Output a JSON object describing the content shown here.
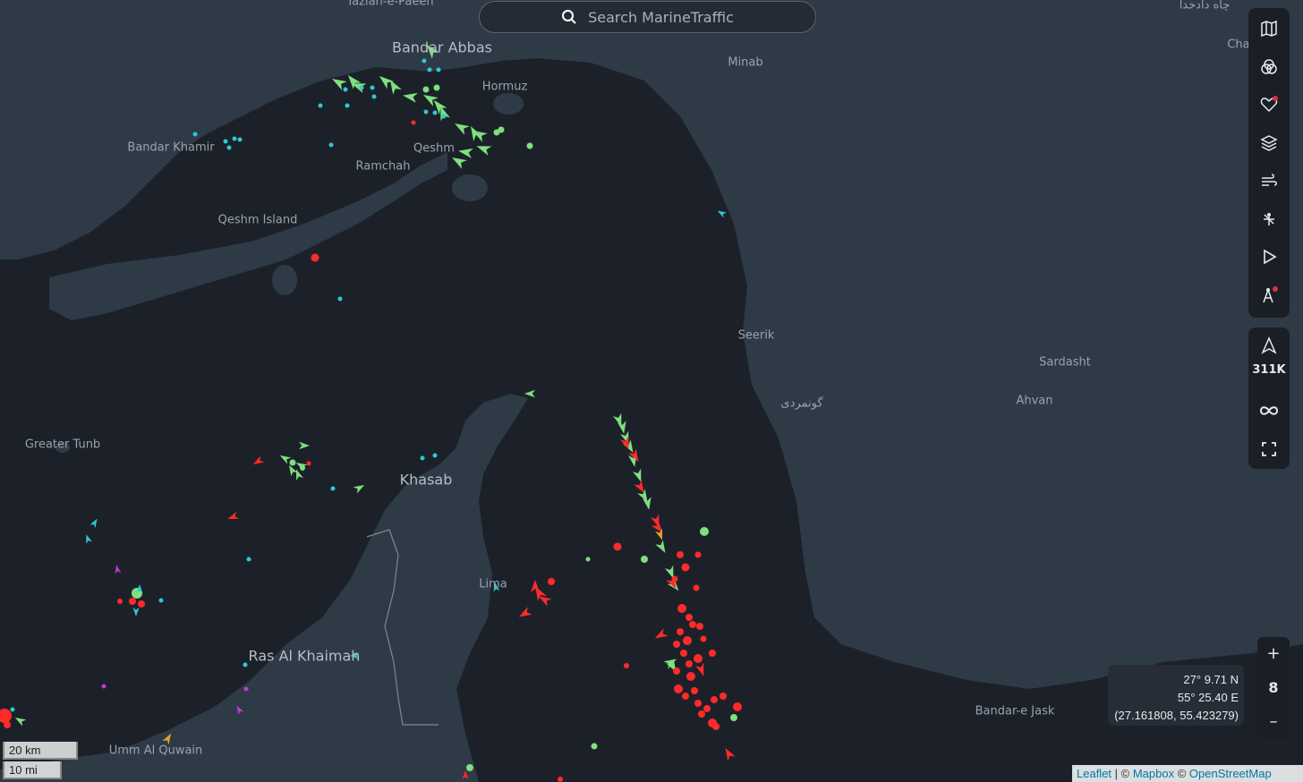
{
  "search": {
    "placeholder": "Search MarineTraffic"
  },
  "places": [
    {
      "id": "tazian",
      "name": "Tazian-e-Paeen"
    },
    {
      "id": "bandar-abbas",
      "name": "Bandar Abbas"
    },
    {
      "id": "minab",
      "name": "Minab"
    },
    {
      "id": "hormuz",
      "name": "Hormuz"
    },
    {
      "id": "qeshm",
      "name": "Qeshm"
    },
    {
      "id": "bandar-khamir",
      "name": "Bandar Khamir"
    },
    {
      "id": "ramchah",
      "name": "Ramchah"
    },
    {
      "id": "qeshm-island",
      "name": "Qeshm Island"
    },
    {
      "id": "seerik",
      "name": "Seerik"
    },
    {
      "id": "sardasht",
      "name": "Sardasht"
    },
    {
      "id": "ahvan",
      "name": "Ahvan"
    },
    {
      "id": "goonmardi",
      "name": "گونمردی"
    },
    {
      "id": "greater-tunb",
      "name": "Greater Tunb"
    },
    {
      "id": "khasab",
      "name": "Khasab"
    },
    {
      "id": "lima",
      "name": "Lima"
    },
    {
      "id": "ras-al-khaimah",
      "name": "Ras Al Khaimah"
    },
    {
      "id": "umm-al-quwain",
      "name": "Umm Al Quwain"
    },
    {
      "id": "bandar-e-jask",
      "name": "Bandar-e Jask"
    },
    {
      "id": "chah-dadkhoda",
      "name": "چاه دادخدا"
    },
    {
      "id": "cha",
      "name": "Cha"
    }
  ],
  "toolbar": {
    "icons": [
      "map-icon",
      "filters-icon",
      "favorites-icon",
      "layers-icon",
      "weather-icon",
      "density-icon",
      "playback-icon",
      "measure-icon"
    ],
    "vessel_count": "311K",
    "extra_icons": [
      "navigation-icon",
      "infinity-icon",
      "fullscreen-icon"
    ]
  },
  "zoom": {
    "in_label": "+",
    "level": "8",
    "out_label": "–"
  },
  "coords": {
    "lat": "27° 9.71 N",
    "lon": "55° 25.40 E",
    "decimal": "(27.161808, 55.423279)"
  },
  "scale": {
    "km": "20 km",
    "mi": "10 mi"
  },
  "attribution": {
    "leaflet": "Leaflet",
    "sep1": " | © ",
    "mapbox": "Mapbox",
    "sep2": " © ",
    "osm": "OpenStreetMap"
  },
  "colors": {
    "water": "#1c2129",
    "land": "#2f3a47",
    "cargo": "#ff2a2a",
    "tanker": "#7ee07e",
    "passenger": "#2ec8d6",
    "other": "#c03ad0",
    "fishing": "#e5a020"
  }
}
